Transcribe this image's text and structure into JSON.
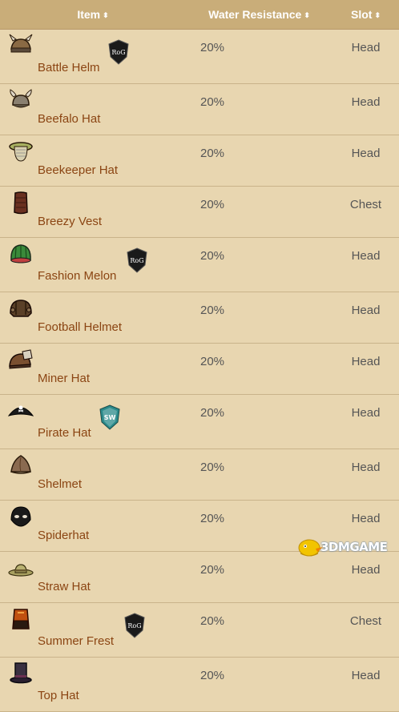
{
  "header": {
    "item": "Item",
    "water_resistance": "Water Resistance",
    "slot": "Slot",
    "sort_glyph": "⬍"
  },
  "colors": {
    "header_bg": "#c9ad79",
    "row_bg": "#e8d6b0",
    "link": "#8b4513",
    "text": "#555555"
  },
  "rows": [
    {
      "name": "Battle Helm",
      "icon": "battle-helm-icon",
      "badge": "RoG",
      "value": "20%",
      "slot": "Head"
    },
    {
      "name": "Beefalo Hat",
      "icon": "beefalo-hat-icon",
      "badge": null,
      "value": "20%",
      "slot": "Head"
    },
    {
      "name": "Beekeeper Hat",
      "icon": "beekeeper-hat-icon",
      "badge": null,
      "value": "20%",
      "slot": "Head"
    },
    {
      "name": "Breezy Vest",
      "icon": "breezy-vest-icon",
      "badge": null,
      "value": "20%",
      "slot": "Chest"
    },
    {
      "name": "Fashion Melon",
      "icon": "fashion-melon-icon",
      "badge": "RoG",
      "value": "20%",
      "slot": "Head"
    },
    {
      "name": "Football Helmet",
      "icon": "football-helmet-icon",
      "badge": null,
      "value": "20%",
      "slot": "Head"
    },
    {
      "name": "Miner Hat",
      "icon": "miner-hat-icon",
      "badge": null,
      "value": "20%",
      "slot": "Head"
    },
    {
      "name": "Pirate Hat",
      "icon": "pirate-hat-icon",
      "badge": "SW",
      "value": "20%",
      "slot": "Head"
    },
    {
      "name": "Shelmet",
      "icon": "shelmet-icon",
      "badge": null,
      "value": "20%",
      "slot": "Head"
    },
    {
      "name": "Spiderhat",
      "icon": "spiderhat-icon",
      "badge": null,
      "value": "20%",
      "slot": "Head"
    },
    {
      "name": "Straw Hat",
      "icon": "straw-hat-icon",
      "badge": null,
      "value": "20%",
      "slot": "Head"
    },
    {
      "name": "Summer Frest",
      "icon": "summer-frest-icon",
      "badge": "RoG",
      "value": "20%",
      "slot": "Chest"
    },
    {
      "name": "Top Hat",
      "icon": "top-hat-icon",
      "badge": null,
      "value": "20%",
      "slot": "Head"
    }
  ],
  "watermark": {
    "text": "3DMGAME"
  }
}
